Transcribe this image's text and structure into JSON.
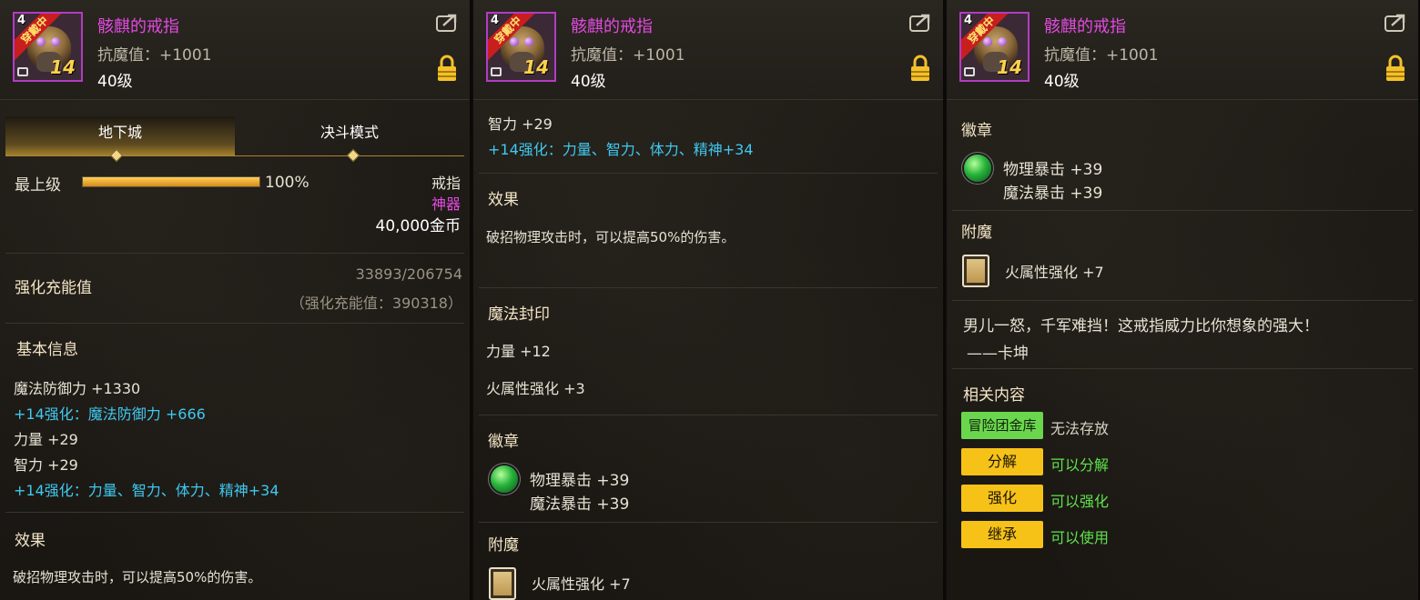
{
  "item": {
    "name": "骸麒的戒指",
    "resist": "抗魔值：+1001",
    "level": "40级",
    "icon_level": "14",
    "icon_badge": "穿戴中",
    "icon_corner": "4"
  },
  "panel1": {
    "tabs": [
      "地下城",
      "决斗模式"
    ],
    "grade_label": "最上级",
    "grade_percent": "100%",
    "grade_value": 1.0,
    "slot_type": "戒指",
    "rarity": "神器",
    "price": "40,000金币",
    "charge_label": "强化充能值",
    "charge_value": "33893/206754",
    "charge_sub": "（强化充能值：390318）",
    "basic_title": "基本信息",
    "basic_lines": [
      {
        "text": "魔法防御力 +1330",
        "cyan": false
      },
      {
        "text": "+14强化：魔法防御力 +666",
        "cyan": true
      },
      {
        "text": "力量 +29",
        "cyan": false
      },
      {
        "text": "智力 +29",
        "cyan": false
      },
      {
        "text": "+14强化：力量、智力、体力、精神+34",
        "cyan": true
      }
    ],
    "effect_title": "效果",
    "effect_text": "破招物理攻击时，可以提高50%的伤害。"
  },
  "panel2": {
    "lines_top": [
      {
        "text": "智力 +29",
        "cyan": false
      },
      {
        "text": "+14强化：力量、智力、体力、精神+34",
        "cyan": true
      }
    ],
    "effect_title": "效果",
    "effect_text": "破招物理攻击时，可以提高50%的伤害。",
    "seal_title": "魔法封印",
    "seal_lines": [
      "力量 +12",
      "火属性强化 +3"
    ],
    "emblem_title": "徽章",
    "emblem_lines": [
      "物理暴击 +39",
      "魔法暴击 +39"
    ],
    "enchant_title": "附魔",
    "enchant_text": "火属性强化 +7"
  },
  "panel3": {
    "emblem_title": "徽章",
    "emblem_lines": [
      "物理暴击 +39",
      "魔法暴击 +39"
    ],
    "enchant_title": "附魔",
    "enchant_text": "火属性强化 +7",
    "quote": "男儿一怒，千军难挡！这戒指威力比你想象的强大！",
    "quote_author": "——卡坤",
    "related_title": "相关内容",
    "related": [
      {
        "button": "冒险团金库",
        "status": "无法存放",
        "style": "green",
        "status_color": "#d8d2c4"
      },
      {
        "button": "分解",
        "status": "可以分解",
        "style": "gold",
        "status_color": "#5fe34a"
      },
      {
        "button": "强化",
        "status": "可以强化",
        "style": "gold",
        "status_color": "#5fe34a"
      },
      {
        "button": "继承",
        "status": "可以使用",
        "style": "gold",
        "status_color": "#5fe34a"
      }
    ]
  }
}
